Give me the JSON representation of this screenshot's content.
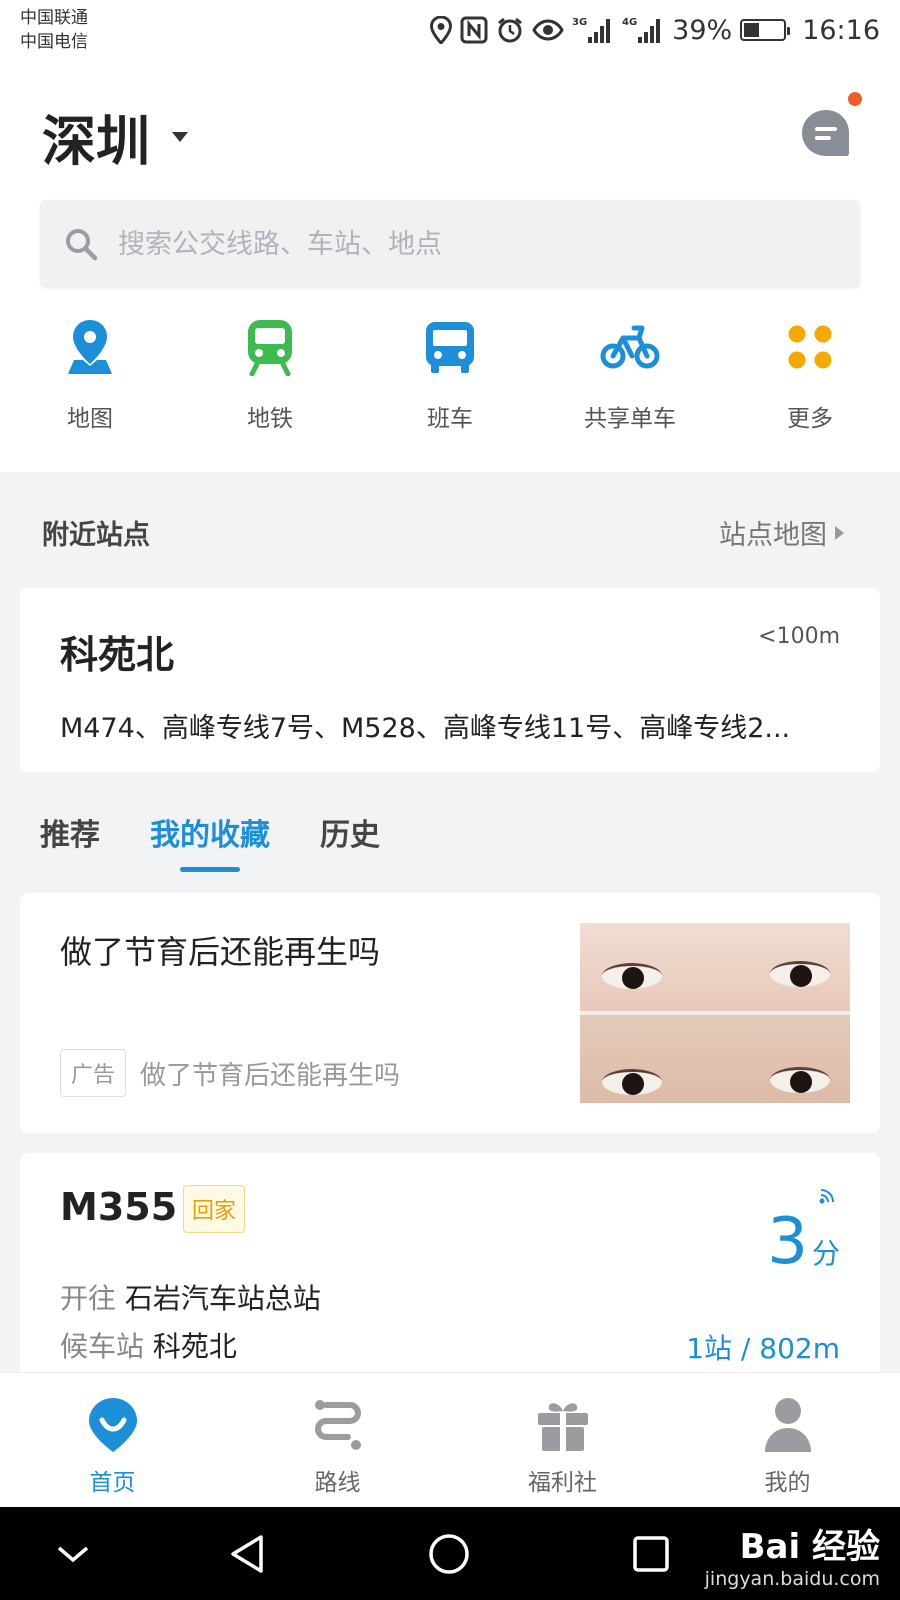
{
  "status_bar": {
    "carriers": [
      "中国联通",
      "中国电信"
    ],
    "network_1": "3G",
    "network_2": "4G",
    "battery_percent": "39%",
    "battery_level": 0.39,
    "time": "16:16",
    "icons": [
      "location-icon",
      "nfc-icon",
      "alarm-icon",
      "eye-comfort-icon",
      "signal-3g-icon",
      "signal-4g-icon",
      "battery-icon"
    ]
  },
  "header": {
    "city": "深圳",
    "message_icon": "chat-icon",
    "has_notification": true
  },
  "search": {
    "placeholder": "搜索公交线路、车站、地点"
  },
  "quick_actions": [
    {
      "label": "地图",
      "icon": "map-pin-icon",
      "color": "#1d8fd8"
    },
    {
      "label": "地铁",
      "icon": "subway-icon",
      "color": "#3dbb4f"
    },
    {
      "label": "班车",
      "icon": "bus-icon",
      "color": "#1d8fd8"
    },
    {
      "label": "共享单车",
      "icon": "bicycle-icon",
      "color": "#1d8fd8"
    },
    {
      "label": "更多",
      "icon": "more-dots-icon",
      "color": "#f5a800"
    }
  ],
  "nearby": {
    "title": "附近站点",
    "map_link": "站点地图",
    "station": {
      "name": "科苑北",
      "distance": "<100m",
      "lines": "M474、高峰专线7号、M528、高峰专线11号、高峰专线2..."
    }
  },
  "tabs": [
    {
      "label": "推荐",
      "active": false
    },
    {
      "label": "我的收藏",
      "active": true
    },
    {
      "label": "历史",
      "active": false
    }
  ],
  "ad": {
    "title": "做了节育后还能再生吗",
    "badge": "广告",
    "subtitle": "做了节育后还能再生吗"
  },
  "bus": {
    "line": "M355",
    "tag": "回家",
    "dest_prefix": "开往",
    "destination": "石岩汽车站总站",
    "stop_prefix": "候车站",
    "stop": "科苑北",
    "eta_value": "3",
    "eta_unit": "分",
    "distance": "1站 / 802m"
  },
  "bottom_tabs": [
    {
      "label": "首页",
      "icon": "home-icon",
      "active": true
    },
    {
      "label": "路线",
      "icon": "route-icon",
      "active": false
    },
    {
      "label": "福利社",
      "icon": "gift-icon",
      "active": false
    },
    {
      "label": "我的",
      "icon": "user-icon",
      "active": false
    }
  ],
  "colors": {
    "accent": "#1d8fd8",
    "notification": "#f25c28",
    "tag_text": "#e6a000"
  },
  "watermark": {
    "logo": "Bai 经验",
    "url": "jingyan.baidu.com"
  }
}
